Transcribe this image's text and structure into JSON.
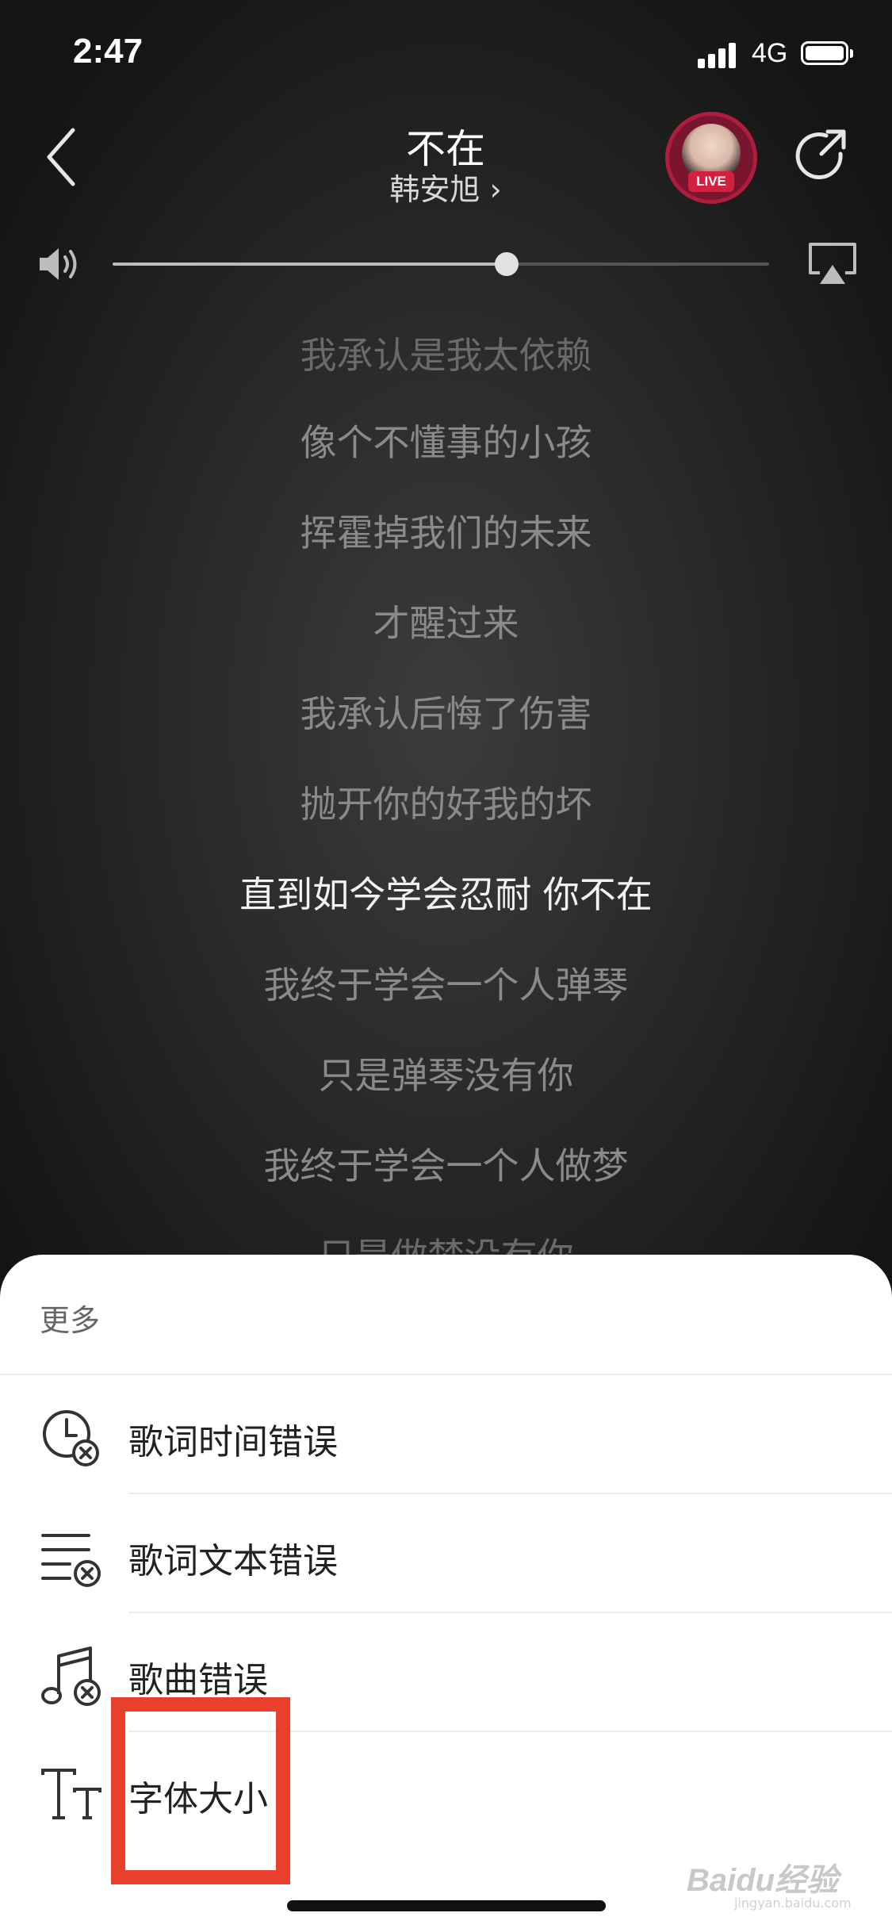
{
  "status_bar": {
    "time": "2:47",
    "network": "4G"
  },
  "header": {
    "title": "不在",
    "artist": "韩安旭 ›",
    "live_badge": "LIVE"
  },
  "volume": {
    "level": 0.6
  },
  "lyrics": {
    "lines": [
      "我承认是我太依赖",
      "像个不懂事的小孩",
      "挥霍掉我们的未来",
      "才醒过来",
      "我承认后悔了伤害",
      "抛开你的好我的坏",
      "直到如今学会忍耐 你不在",
      "我终于学会一个人弹琴",
      "只是弹琴没有你",
      "我终于学会一个人做梦",
      "只是做梦没有你"
    ],
    "current_index": 6
  },
  "sheet": {
    "title": "更多",
    "items": [
      {
        "label": "歌词时间错误",
        "icon": "clock-error-icon"
      },
      {
        "label": "歌词文本错误",
        "icon": "text-error-icon"
      },
      {
        "label": "歌曲错误",
        "icon": "music-error-icon"
      },
      {
        "label": "字体大小",
        "icon": "font-size-icon"
      }
    ]
  },
  "watermark": {
    "text": "Baidu经验",
    "sub": "jingyan.baidu.com"
  },
  "colors": {
    "highlight": "#e8402c",
    "live_badge": "#d42040"
  }
}
